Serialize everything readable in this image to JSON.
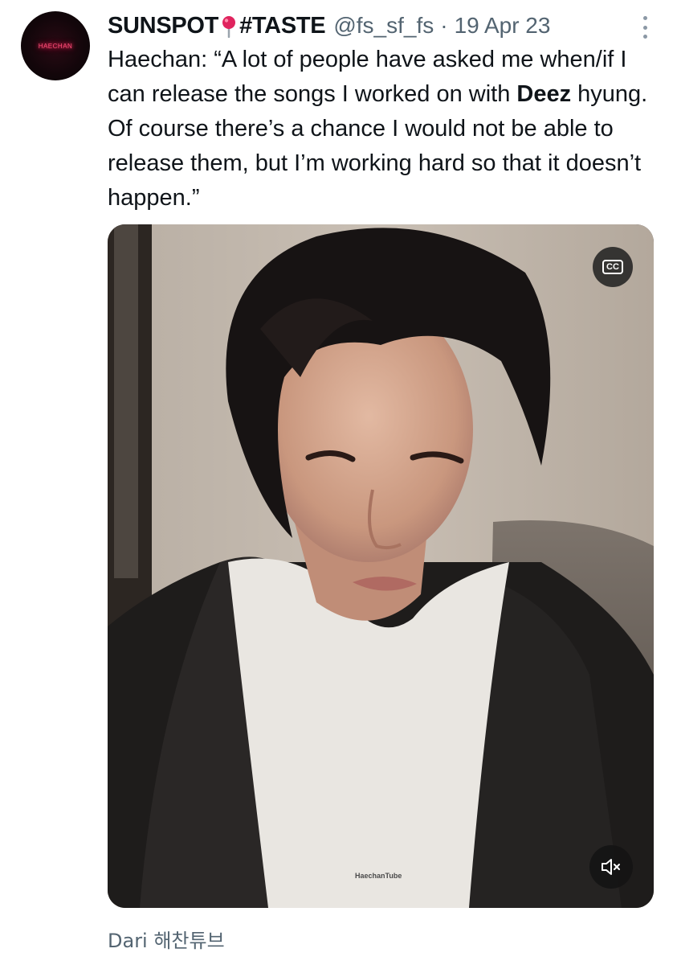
{
  "author": {
    "avatar_text": "HAECHAN",
    "display_name": "SUNSPOT",
    "name_emoji": "round-pushpin",
    "hashtag": "#TASTE",
    "handle": "@fs_sf_fs",
    "separator": "·",
    "date": "19 Apr 23"
  },
  "tweet": {
    "text_before": "Haechan: “A lot of people have asked me when/if I can release the songs I worked on with ",
    "text_bold": "Deez",
    "text_after": " hyung. Of course there’s a chance I would not be able to release them, but I’m working hard so that it doesn’t happen.”"
  },
  "media": {
    "cc_label": "CC",
    "watermark": "HaechanTube",
    "mute_icon": "speaker-muted-icon"
  },
  "caption": "Dari 해찬튜브",
  "colors": {
    "text": "#0f1419",
    "secondary": "#536471",
    "pin_red": "#e0245e",
    "avatar_neon": "#ff4f7a"
  }
}
